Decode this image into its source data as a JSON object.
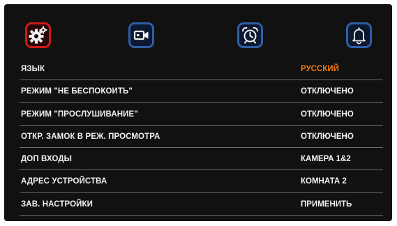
{
  "icon_bar": {
    "items": [
      {
        "icon": "settings-gear-icon",
        "active": true
      },
      {
        "icon": "video-camera-icon",
        "active": false
      },
      {
        "icon": "alarm-clock-icon",
        "active": false
      },
      {
        "icon": "bell-icon",
        "active": false
      }
    ],
    "active_color": "#d01a1a",
    "inactive_color": "#2f5ea8"
  },
  "settings": {
    "rows": [
      {
        "label": "ЯЗЫК",
        "value": "РУССКИЙ"
      },
      {
        "label": "РЕЖИМ \"НЕ БЕСПОКОИТЬ\"",
        "value": "ОТКЛЮЧЕНО"
      },
      {
        "label": "РЕЖИМ \"ПРОСЛУШИВАНИЕ\"",
        "value": "ОТКЛЮЧЕНО"
      },
      {
        "label": "ОТКР. ЗАМОК В РЕЖ. ПРОСМОТРА",
        "value": "ОТКЛЮЧЕНО"
      },
      {
        "label": "ДОП ВХОДЫ",
        "value": "КАМЕРА 1&2"
      },
      {
        "label": "АДРЕС УСТРОЙСТВА",
        "value": "КОМНАТА 2"
      },
      {
        "label": "ЗАВ. НАСТРОЙКИ",
        "value": "ПРИМЕНИТЬ"
      }
    ],
    "selected_value_color": "#f07c15"
  }
}
